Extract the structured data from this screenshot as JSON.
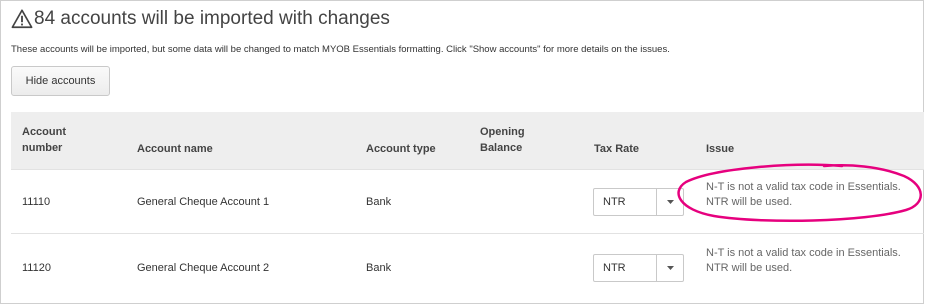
{
  "header": {
    "title": "84 accounts will be imported with changes",
    "subtitle": "These accounts will be imported, but some data will be changed to match MYOB Essentials formatting. Click \"Show accounts\" for more details on the issues.",
    "hide_button": "Hide accounts"
  },
  "table": {
    "columns": {
      "account_number": "Account number",
      "account_name": "Account name",
      "account_type": "Account type",
      "opening_balance": "Opening Balance",
      "tax_rate": "Tax Rate",
      "issue": "Issue"
    },
    "rows": [
      {
        "account_number": "11110",
        "account_name": "General Cheque Account 1",
        "account_type": "Bank",
        "tax_rate": "NTR",
        "issue_line1": "N-T is not a valid tax code in Essentials.",
        "issue_line2": "NTR will be used."
      },
      {
        "account_number": "11120",
        "account_name": "General Cheque Account 2",
        "account_type": "Bank",
        "tax_rate": "NTR",
        "issue_line1": "N-T is not a valid tax code in Essentials.",
        "issue_line2": "NTR will be used."
      }
    ]
  },
  "colors": {
    "highlight": "#e6007e",
    "header_bg": "#eeeeee"
  }
}
